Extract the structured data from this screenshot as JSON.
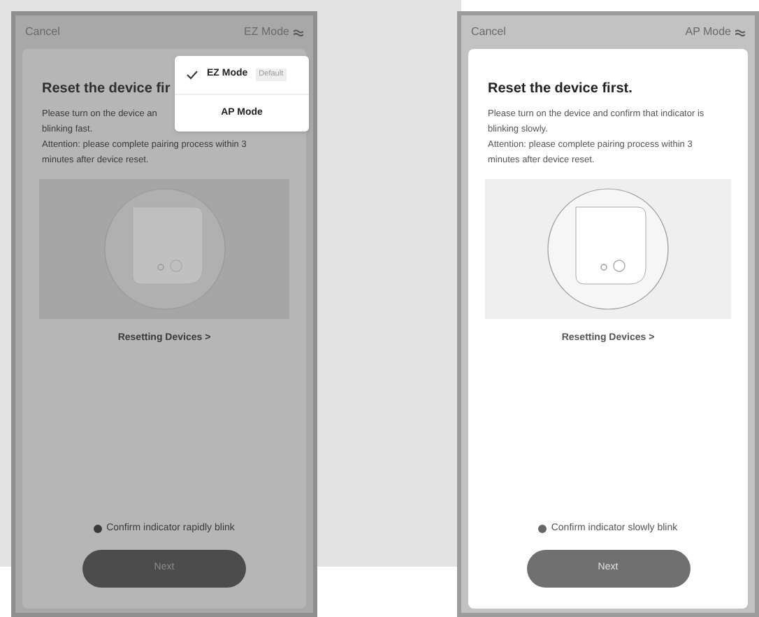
{
  "screens": [
    {
      "dimmed": true,
      "cancel": "Cancel",
      "mode": "EZ Mode",
      "title": "Reset the device fir",
      "paragraphs": [
        "Please turn on the device an",
        "blinking fast.",
        "Attention: please complete pairing process within 3",
        "minutes after device reset."
      ],
      "link": "Resetting Devices >",
      "confirm": "Confirm indicator rapidly blink",
      "button": "Next",
      "menu": {
        "items": [
          {
            "label": "EZ Mode",
            "badge": "Default",
            "selected": true
          },
          {
            "label": "AP Mode",
            "selected": false
          }
        ]
      }
    },
    {
      "dimmed": false,
      "cancel": "Cancel",
      "mode": "AP Mode",
      "title": "Reset the device first.",
      "paragraphs": [
        "Please turn on the device and confirm that indicator is",
        "blinking slowly.",
        "Attention: please complete pairing process within 3",
        "minutes after device reset."
      ],
      "link": "Resetting Devices >",
      "confirm": "Confirm indicator slowly blink",
      "button": "Next"
    }
  ]
}
